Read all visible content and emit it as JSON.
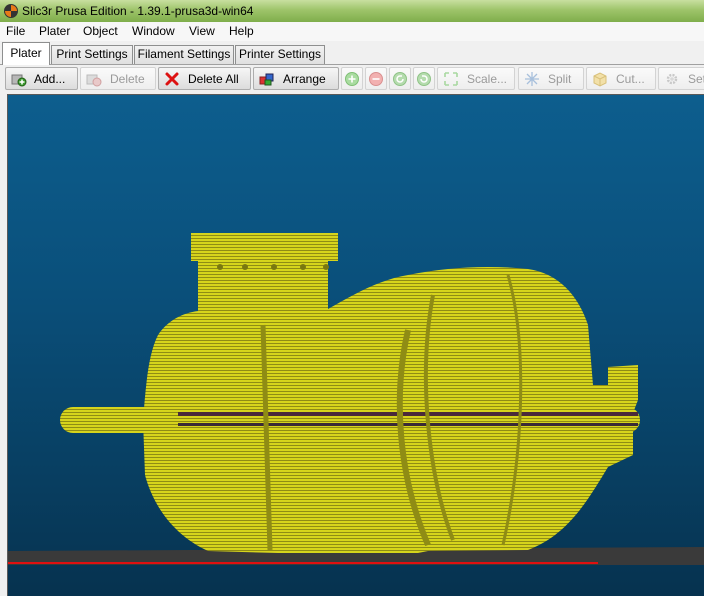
{
  "window": {
    "title": "Slic3r Prusa Edition - 1.39.1-prusa3d-win64",
    "icon": "slic3r-app-icon"
  },
  "menu": [
    "File",
    "Plater",
    "Object",
    "Window",
    "View",
    "Help"
  ],
  "tabs": [
    {
      "label": "Plater",
      "active": true
    },
    {
      "label": "Print Settings",
      "active": false
    },
    {
      "label": "Filament Settings",
      "active": false
    },
    {
      "label": "Printer Settings",
      "active": false
    }
  ],
  "toolbar": {
    "add": {
      "label": "Add...",
      "icon": "add-brick-icon",
      "enabled": true
    },
    "delete": {
      "label": "Delete",
      "icon": "delete-brick-icon",
      "enabled": false
    },
    "delete_all": {
      "label": "Delete All",
      "icon": "cross-icon",
      "enabled": true
    },
    "arrange": {
      "label": "Arrange",
      "icon": "arrange-bricks-icon",
      "enabled": true
    },
    "increase": {
      "icon": "plus-circle-icon",
      "enabled": false
    },
    "decrease": {
      "icon": "minus-circle-icon",
      "enabled": false
    },
    "rotate_ccw": {
      "icon": "rotate-left-icon",
      "enabled": false
    },
    "rotate_cw": {
      "icon": "rotate-right-icon",
      "enabled": false
    },
    "scale": {
      "label": "Scale...",
      "icon": "scale-arrows-icon",
      "enabled": false
    },
    "split": {
      "label": "Split",
      "icon": "split-icon",
      "enabled": false
    },
    "cut": {
      "label": "Cut...",
      "icon": "package-icon",
      "enabled": false
    },
    "settings": {
      "label": "Set",
      "icon": "gear-icon",
      "enabled": false
    }
  },
  "colors": {
    "model": "#d6d41c",
    "model_shadow": "#8d8a12",
    "viewport_top": "#0d5e8e",
    "viewport_bottom": "#06324f",
    "bed_edge": "#e01010",
    "accent_red": "#c80000"
  }
}
